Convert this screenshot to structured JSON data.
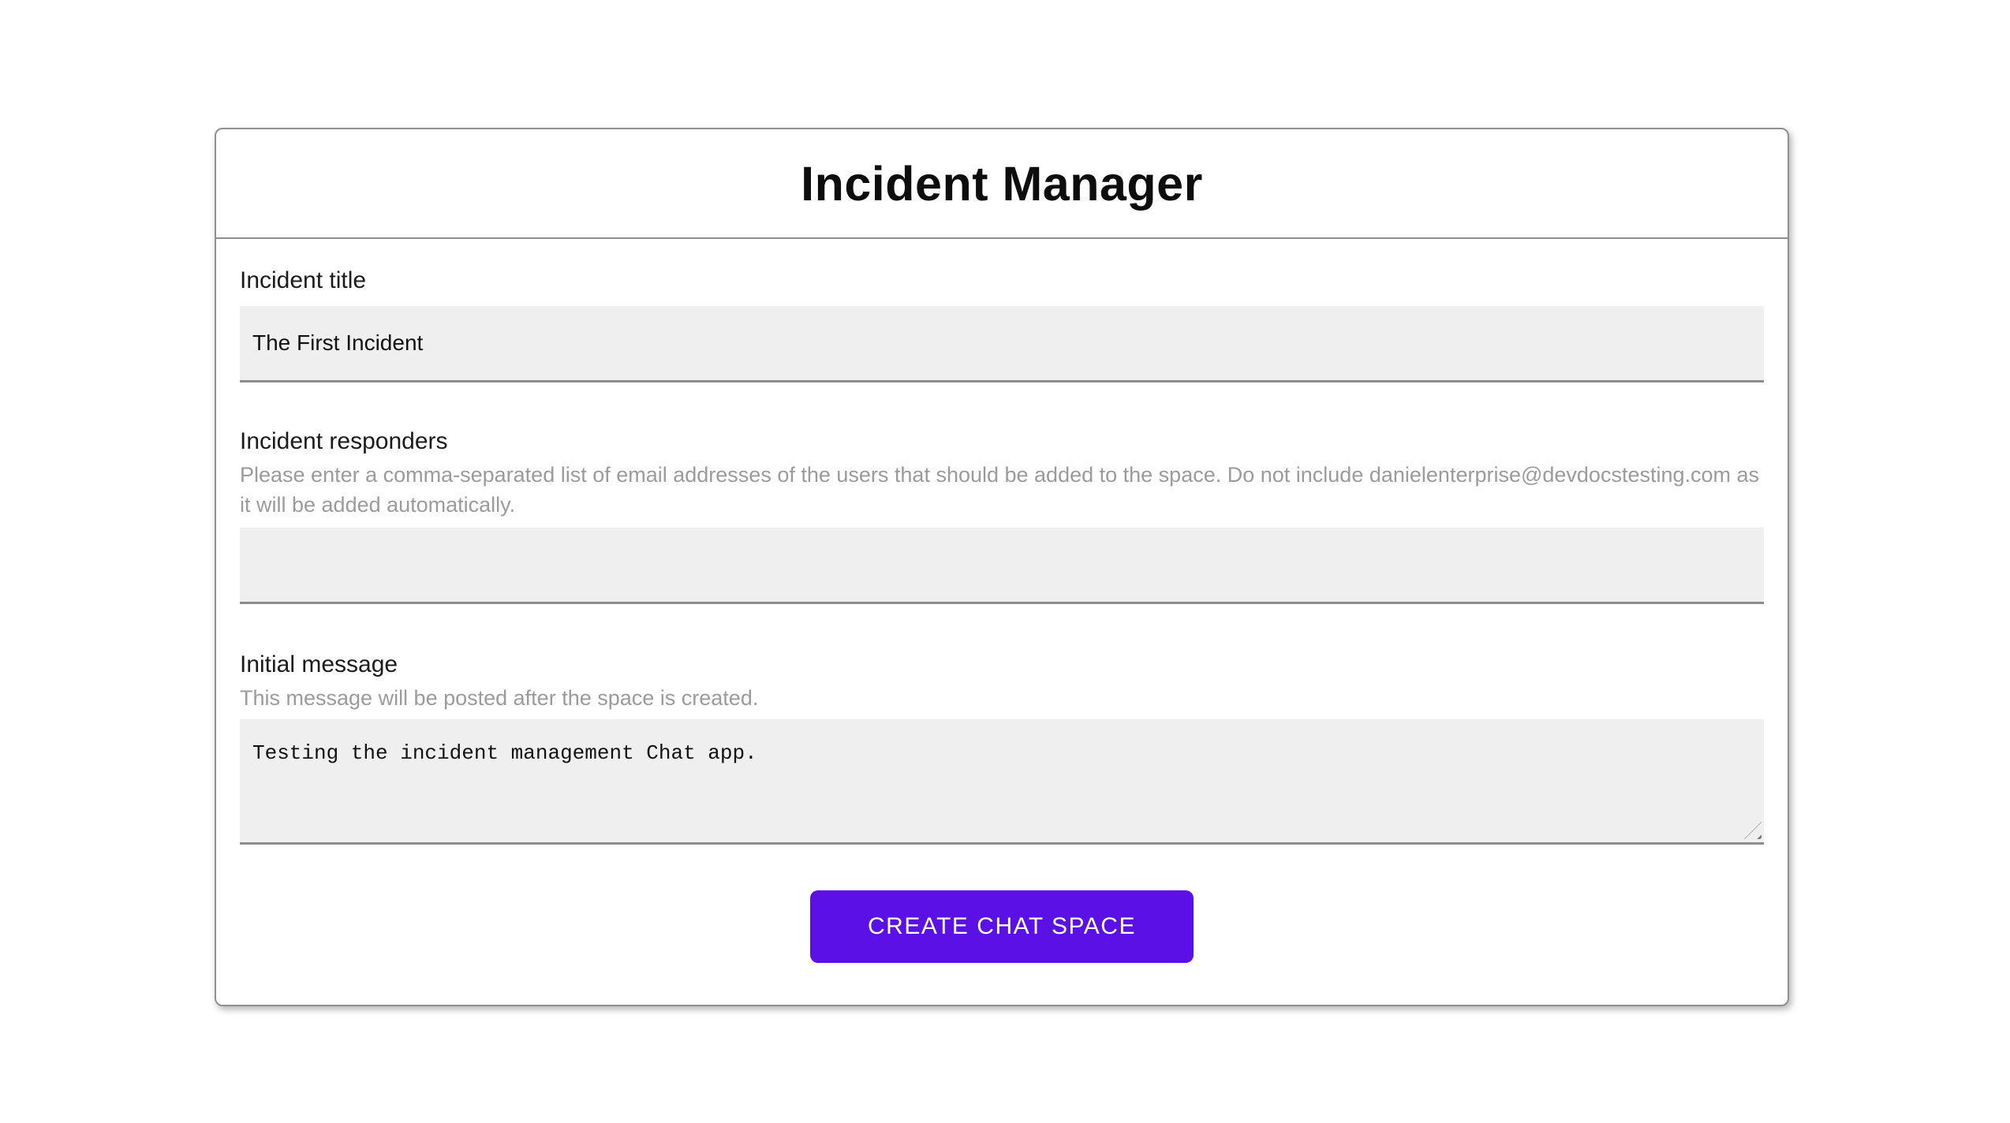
{
  "app": {
    "title": "Incident Manager"
  },
  "form": {
    "incident_title": {
      "label": "Incident title",
      "value": "The First Incident"
    },
    "incident_responders": {
      "label": "Incident responders",
      "helper": "Please enter a comma-separated list of email addresses of the users that should be added to the space. Do not include danielenterprise@devdocstesting.com as it will be added automatically.",
      "value": ""
    },
    "initial_message": {
      "label": "Initial message",
      "helper": "This message will be posted after the space is created.",
      "value": "Testing the incident management Chat app."
    }
  },
  "actions": {
    "create_button_label": "CREATE CHAT SPACE"
  },
  "colors": {
    "accent": "#5b11e6",
    "input_background": "#efefef",
    "input_underline": "#8d8d8d",
    "helper_text": "#9b9b9b",
    "card_border": "#909090"
  }
}
